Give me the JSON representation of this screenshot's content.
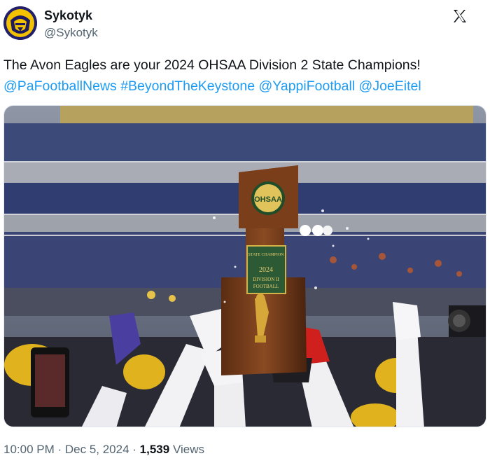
{
  "author": {
    "name": "Sykotyk",
    "handle": "@Sykotyk",
    "avatar_icon": "eagle-mascot-avatar"
  },
  "tweet": {
    "text": "The Avon Eagles are your 2024 OHSAA Division 2 State Champions!",
    "mentions": [
      "@PaFootballNews",
      "#BeyondTheKeystone",
      "@YappiFootball",
      "@JoeEitel"
    ]
  },
  "media": {
    "alt_icon": "trophy-photo",
    "trophy": {
      "badge": "OHSAA",
      "plate_line1": "STATE CHAMPION",
      "plate_line2": "2024",
      "plate_line3": "DIVISION II",
      "plate_line4": "FOOTBALL"
    }
  },
  "meta": {
    "time": "10:00 PM",
    "date": "Dec 5, 2024",
    "views_count": "1,539",
    "views_label": "Views"
  },
  "colors": {
    "link": "#1d9bf0",
    "text": "#0f1419",
    "secondary": "#536471"
  }
}
